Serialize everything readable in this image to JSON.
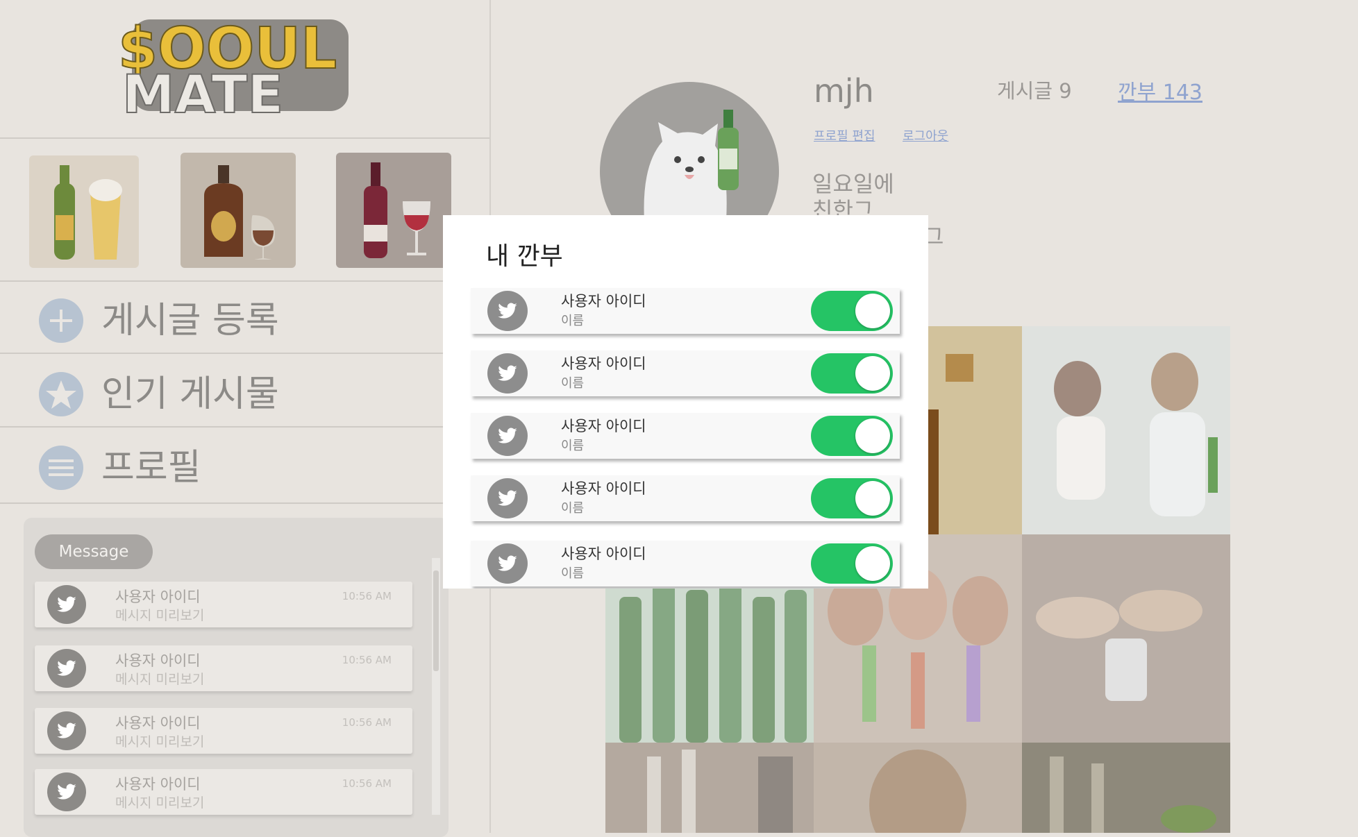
{
  "app": {
    "logo_text": "$OOUL MATE"
  },
  "sidebar": {
    "nav": [
      {
        "label": "게시글 등록",
        "icon": "plus-icon"
      },
      {
        "label": "인기 게시물",
        "icon": "star-icon"
      },
      {
        "label": "프로필",
        "icon": "menu-icon"
      }
    ],
    "categories": [
      "beer",
      "whiskey",
      "wine"
    ]
  },
  "messages": {
    "badge": "Message",
    "items": [
      {
        "user": "사용자 아이디",
        "preview": "메시지 미리보기",
        "time": "10:56 AM"
      },
      {
        "user": "사용자 아이디",
        "preview": "메시지 미리보기",
        "time": "10:56 AM"
      },
      {
        "user": "사용자 아이디",
        "preview": "메시지 미리보기",
        "time": "10:56 AM"
      },
      {
        "user": "사용자 아이디",
        "preview": "메시지 미리보기",
        "time": "10:56 AM"
      }
    ]
  },
  "profile": {
    "username": "mjh",
    "posts_label": "게시글 9",
    "friends_label": "깐부 143",
    "edit_link": "프로필 편집",
    "logout_link": "로그아웃",
    "bio_line1": "일요일에",
    "bio_line2": "친한그",
    "bio_line3": "그"
  },
  "modal": {
    "title": "내 깐부",
    "items": [
      {
        "user": "사용자 아이디",
        "name": "이름",
        "enabled": true
      },
      {
        "user": "사용자 아이디",
        "name": "이름",
        "enabled": true
      },
      {
        "user": "사용자 아이디",
        "name": "이름",
        "enabled": true
      },
      {
        "user": "사용자 아이디",
        "name": "이름",
        "enabled": true
      },
      {
        "user": "사용자 아이디",
        "name": "이름",
        "enabled": true
      }
    ]
  },
  "colors": {
    "toggle_on": "#25c465",
    "link": "#8fa3cf",
    "background": "#e8e4df"
  }
}
